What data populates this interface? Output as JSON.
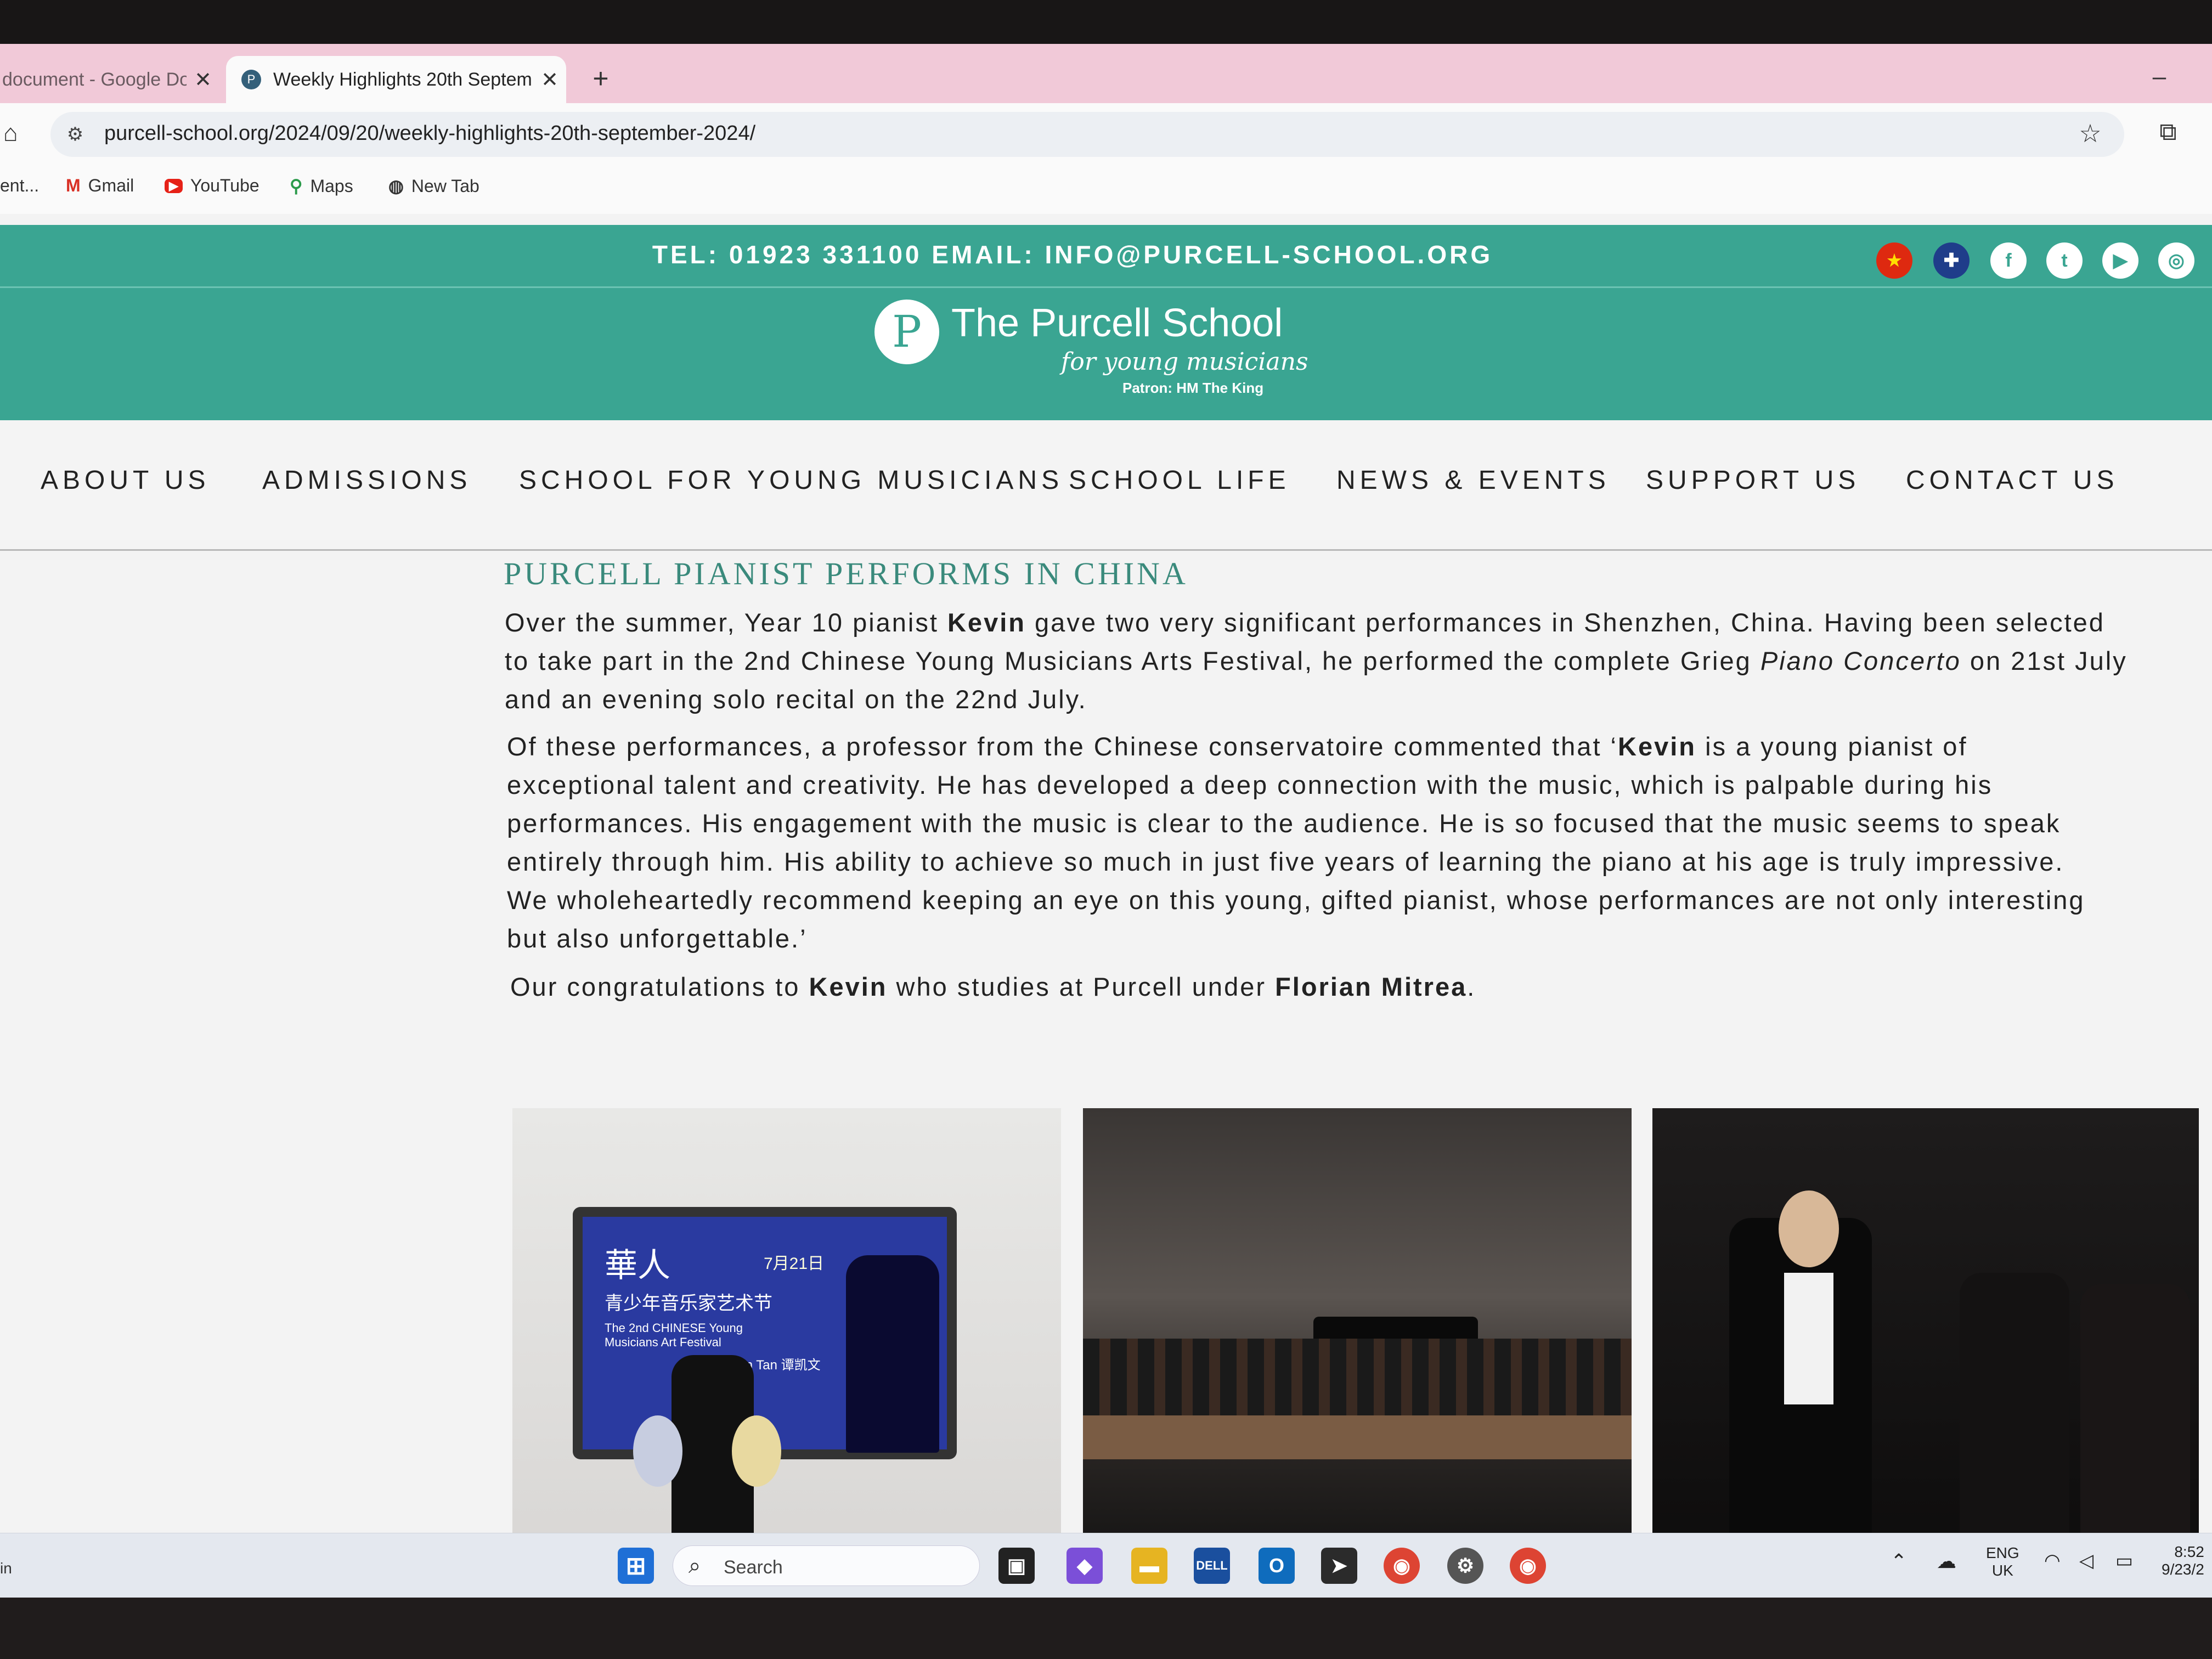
{
  "browser": {
    "tabs": [
      {
        "title": "document - Google Do",
        "close": "✕"
      },
      {
        "title": "Weekly Highlights 20th Septem",
        "close": "✕"
      }
    ],
    "new_tab": "+",
    "minimize": "–",
    "url": "purcell-school.org/2024/09/20/weekly-highlights-20th-september-2024/",
    "bookmarks": [
      {
        "label": "ent...",
        "icon": ""
      },
      {
        "label": "Gmail",
        "icon": "M"
      },
      {
        "label": "YouTube",
        "icon": "▶"
      },
      {
        "label": "Maps",
        "icon": "⚲"
      },
      {
        "label": "New Tab",
        "icon": "◍"
      }
    ]
  },
  "site": {
    "contact_line": "TEL: 01923 331100 EMAIL: INFO@PURCELL-SCHOOL.ORG",
    "social_icons": [
      {
        "name": "china-flag-icon",
        "glyph": "★"
      },
      {
        "name": "uk-flag-icon",
        "glyph": "✚"
      },
      {
        "name": "facebook-icon",
        "glyph": "f"
      },
      {
        "name": "twitter-icon",
        "glyph": "t"
      },
      {
        "name": "youtube-icon",
        "glyph": "▶"
      },
      {
        "name": "instagram-icon",
        "glyph": "◎"
      }
    ],
    "logo": {
      "glyph": "P",
      "name": "The Purcell School",
      "tagline": "for young musicians",
      "patron": "Patron: HM The King"
    },
    "nav": [
      "ABOUT US",
      "ADMISSIONS",
      "SCHOOL FOR YOUNG MUSICIANS",
      "SCHOOL LIFE",
      "NEWS & EVENTS",
      "SUPPORT US",
      "CONTACT US"
    ]
  },
  "article": {
    "heading": "PURCELL PIANIST PERFORMS IN CHINA",
    "p1": {
      "lines": [
        [
          "Over the summer, Year 10 pianist ",
          {
            "b": "Kevin"
          },
          " gave two very significant performances in Shenzhen, China. Having been selected"
        ],
        [
          "to take part in the 2nd Chinese Young Musicians Arts Festival, he performed the complete Grieg ",
          {
            "i": "Piano Concerto"
          },
          " on 21st July"
        ],
        [
          "and an evening solo recital on the 22nd July."
        ]
      ]
    },
    "p2": {
      "lines": [
        [
          "Of these performances, a professor from the Chinese conservatoire commented that ‘",
          {
            "b": "Kevin"
          },
          " is a young pianist of"
        ],
        [
          "exceptional talent and creativity. He has developed a deep connection with the music, which is palpable during his"
        ],
        [
          "performances. His engagement with the music is clear to the audience. He is so focused that the music seems to speak"
        ],
        [
          "entirely through him. His ability to achieve so much in just five years of learning the piano at his age is truly impressive."
        ],
        [
          "We wholeheartedly recommend keeping an eye on this young, gifted pianist, whose performances are not only interesting"
        ],
        [
          "but also unforgettable.’"
        ]
      ]
    },
    "p3": {
      "lines": [
        [
          "Our congratulations to ",
          {
            "b": "Kevin"
          },
          " who studies at Purcell under ",
          {
            "b": "Florian Mitrea"
          },
          "."
        ]
      ]
    },
    "photos": {
      "poster_title": "華人",
      "poster_subtitle": "青少年音乐家艺术节",
      "poster_date": "7月21日",
      "poster_english": "The 2nd CHINESE Young Musicians Art Festival",
      "poster_name": "Kevin Tan 谭凯文"
    }
  },
  "taskbar": {
    "left_text": "in",
    "search_placeholder": "Search",
    "language": "ENG",
    "region": "UK",
    "time": "8:52",
    "date": "9/23/2"
  }
}
